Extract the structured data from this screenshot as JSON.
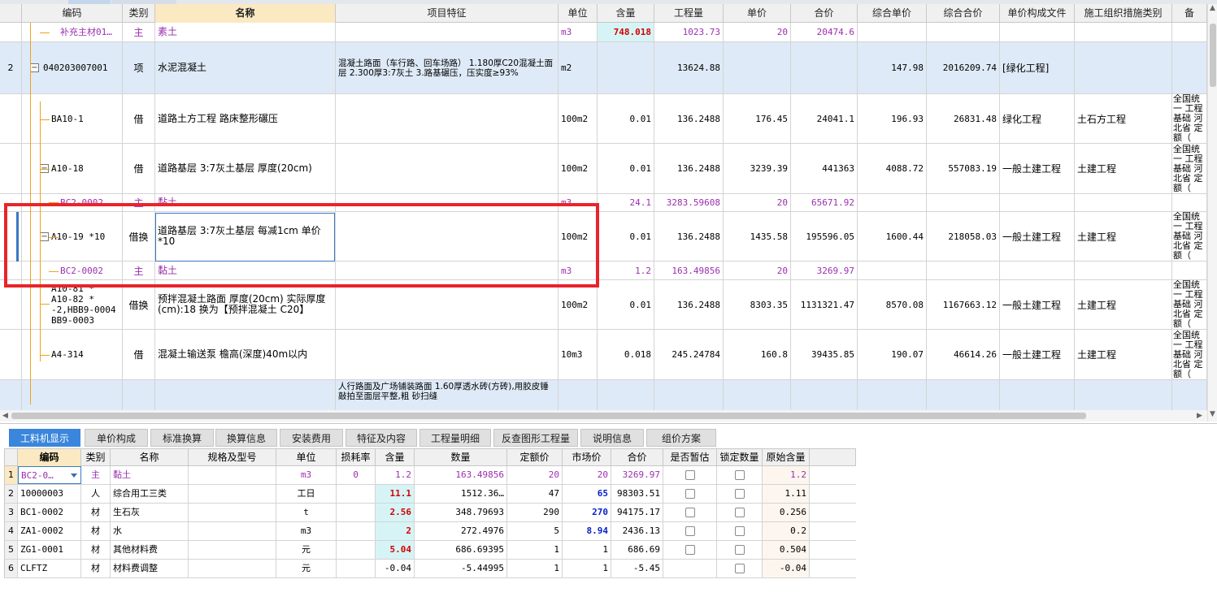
{
  "upper": {
    "columns": [
      "编码",
      "类别",
      "名称",
      "项目特征",
      "单位",
      "含量",
      "工程量",
      "单价",
      "合价",
      "综合单价",
      "综合合价",
      "单价构成文件",
      "施工组织措施类别",
      "备"
    ],
    "rows": [
      {
        "code": "补充主材01…",
        "type": "主",
        "name": "素土",
        "feature": "",
        "unit": "m3",
        "content": "748.018",
        "qty": "1023.73",
        "price": "20",
        "total": "20474.6",
        "uprice": "",
        "utotal": "",
        "file": "",
        "measure": "",
        "note": ""
      },
      {
        "seq": "2",
        "code": "040203007001",
        "type": "项",
        "name": "水泥混凝土",
        "feature": "混凝土路面（车行路、回车场路）\n1.180厚C20混凝土面层\n2.300厚3:7灰土\n3.路基碾压，压实度≥93%",
        "unit": "m2",
        "content": "",
        "qty": "13624.88",
        "price": "",
        "total": "",
        "uprice": "147.98",
        "utotal": "2016209.74",
        "file": "[绿化工程]",
        "measure": "",
        "note": ""
      },
      {
        "code": "BA10-1",
        "type": "借",
        "name": "道路土方工程 路床整形碾压",
        "feature": "",
        "unit": "100m2",
        "content": "0.01",
        "qty": "136.2488",
        "price": "176.45",
        "total": "24041.1",
        "uprice": "196.93",
        "utotal": "26831.48",
        "file": "绿化工程",
        "measure": "土石方工程",
        "note": "全国统一\n工程基础\n河北省\n定额（"
      },
      {
        "code": "A10-18",
        "type": "借",
        "name": "道路基层 3:7灰土基层 厚度(20cm)",
        "feature": "",
        "unit": "100m2",
        "content": "0.01",
        "qty": "136.2488",
        "price": "3239.39",
        "total": "441363",
        "uprice": "4088.72",
        "utotal": "557083.19",
        "file": "一般土建工程",
        "measure": "土建工程",
        "note": "全国统一\n工程基础\n河北省\n定额（"
      },
      {
        "code": "BC2-0002",
        "type": "主",
        "name": "黏土",
        "feature": "",
        "unit": "m3",
        "content": "24.1",
        "qty": "3283.59608",
        "price": "20",
        "total": "65671.92",
        "uprice": "",
        "utotal": "",
        "file": "",
        "measure": "",
        "note": ""
      },
      {
        "code": "A10-19 *10",
        "type": "借换",
        "name": "道路基层 3:7灰土基层 每减1cm  单价 *10",
        "feature": "",
        "unit": "100m2",
        "content": "0.01",
        "qty": "136.2488",
        "price": "1435.58",
        "total": "195596.05",
        "uprice": "1600.44",
        "utotal": "218058.03",
        "file": "一般土建工程",
        "measure": "土建工程",
        "note": "全国统一\n工程基础\n河北省\n定额（"
      },
      {
        "code": "BC2-0002",
        "type": "主",
        "name": "黏土",
        "feature": "",
        "unit": "m3",
        "content": "1.2",
        "qty": "163.49856",
        "price": "20",
        "total": "3269.97",
        "uprice": "",
        "utotal": "",
        "file": "",
        "measure": "",
        "note": ""
      },
      {
        "code": "A10-81 *\nA10-82 *\n-2,HBB9-0004\nBB9-0003",
        "type": "借换",
        "name": "预拌混凝土路面 厚度(20cm)  实际厚度(cm):18  换为【预拌混凝土 C20】",
        "feature": "",
        "unit": "100m2",
        "content": "0.01",
        "qty": "136.2488",
        "price": "8303.35",
        "total": "1131321.47",
        "uprice": "8570.08",
        "utotal": "1167663.12",
        "file": "一般土建工程",
        "measure": "土建工程",
        "note": "全国统一\n工程基础\n河北省\n定额（"
      },
      {
        "code": "A4-314",
        "type": "借",
        "name": "混凝土输送泵 檐高(深度)40m以内",
        "feature": "",
        "unit": "10m3",
        "content": "0.018",
        "qty": "245.24784",
        "price": "160.8",
        "total": "39435.85",
        "uprice": "190.07",
        "utotal": "46614.26",
        "file": "一般土建工程",
        "measure": "土建工程",
        "note": "全国统一\n工程基础\n河北省\n定额（"
      },
      {
        "code": "",
        "type": "",
        "name": "",
        "feature": "人行路面及广场铺装路面\n1.60厚透水砖(方砖),用胶皮锤敲拍至面层平整,粗\n砂扫缝",
        "unit": "",
        "content": "",
        "qty": "",
        "price": "",
        "total": "",
        "uprice": "",
        "utotal": "",
        "file": "",
        "measure": "",
        "note": ""
      }
    ]
  },
  "tabs": [
    "工料机显示",
    "单价构成",
    "标准换算",
    "换算信息",
    "安装费用",
    "特征及内容",
    "工程量明细",
    "反查图形工程量",
    "说明信息",
    "组价方案"
  ],
  "lower": {
    "columns": [
      "编码",
      "类别",
      "名称",
      "规格及型号",
      "单位",
      "损耗率",
      "含量",
      "数量",
      "定额价",
      "市场价",
      "合价",
      "是否暂估",
      "锁定数量",
      "原始含量"
    ],
    "rows": [
      {
        "seq": "1",
        "code": "BC2-0…",
        "type": "主",
        "name": "黏土",
        "spec": "",
        "unit": "m3",
        "loss": "0",
        "content": "1.2",
        "qty": "163.49856",
        "dprice": "20",
        "mprice": "20",
        "total": "3269.97",
        "orig": "1.2"
      },
      {
        "seq": "2",
        "code": "10000003",
        "type": "人",
        "name": "综合用工三类",
        "spec": "",
        "unit": "工日",
        "loss": "",
        "content": "11.1",
        "qty": "1512.36…",
        "dprice": "47",
        "mprice": "65",
        "total": "98303.51",
        "orig": "1.11"
      },
      {
        "seq": "3",
        "code": "BC1-0002",
        "type": "材",
        "name": "生石灰",
        "spec": "",
        "unit": "t",
        "loss": "",
        "content": "2.56",
        "qty": "348.79693",
        "dprice": "290",
        "mprice": "270",
        "total": "94175.17",
        "orig": "0.256"
      },
      {
        "seq": "4",
        "code": "ZA1-0002",
        "type": "材",
        "name": "水",
        "spec": "",
        "unit": "m3",
        "loss": "",
        "content": "2",
        "qty": "272.4976",
        "dprice": "5",
        "mprice": "8.94",
        "total": "2436.13",
        "orig": "0.2"
      },
      {
        "seq": "5",
        "code": "ZG1-0001",
        "type": "材",
        "name": "其他材料费",
        "spec": "",
        "unit": "元",
        "loss": "",
        "content": "5.04",
        "qty": "686.69395",
        "dprice": "1",
        "mprice": "1",
        "total": "686.69",
        "orig": "0.504"
      },
      {
        "seq": "6",
        "code": "CLFTZ",
        "type": "材",
        "name": "材料费调整",
        "spec": "",
        "unit": "元",
        "loss": "",
        "content": "-0.04",
        "qty": "-5.44995",
        "dprice": "1",
        "mprice": "1",
        "total": "-5.45",
        "orig": "-0.04"
      }
    ]
  }
}
